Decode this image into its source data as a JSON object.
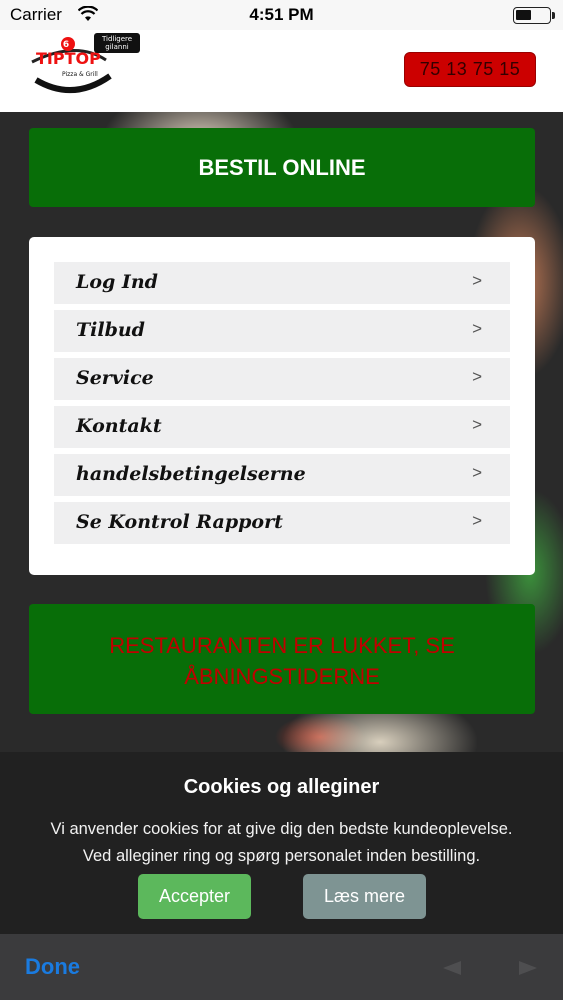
{
  "status_bar": {
    "carrier": "Carrier",
    "time": "4:51 PM"
  },
  "header": {
    "logo_main": "TIPTOP",
    "logo_sub": "Pizza & Grill",
    "logo_badge_line1": "Tidligere",
    "logo_badge_line2": "gilanni",
    "phone": "75 13 75 15"
  },
  "order_button": {
    "label": "BESTIL ONLINE"
  },
  "menu": {
    "items": [
      {
        "label": "Log Ind",
        "chevron": ">"
      },
      {
        "label": "Tilbud",
        "chevron": ">"
      },
      {
        "label": "Service",
        "chevron": ">"
      },
      {
        "label": "Kontakt",
        "chevron": ">"
      },
      {
        "label": "handelsbetingelserne",
        "chevron": ">"
      },
      {
        "label": "Se Kontrol Rapport",
        "chevron": ">"
      }
    ]
  },
  "closed_banner": {
    "line1": "RESTAURANTEN ER LUKKET, SE",
    "line2": "ÅBNINGSTIDERNE"
  },
  "cookie": {
    "title": "Cookies og alleginer",
    "line1": "Vi anvender cookies for at give dig den bedste kundeoplevelse.",
    "line2": "Ved alleginer ring og spørg personalet inden bestilling.",
    "accept_label": "Accepter",
    "read_more_label": "Læs mere"
  },
  "toolbar": {
    "done_label": "Done"
  },
  "colors": {
    "order_green": "#086e08",
    "phone_red": "#cc0000",
    "accept_green": "#5cb85c",
    "read_more_gray": "#7e9493",
    "done_blue": "#1a7be0"
  },
  "icons": [
    "wifi-icon",
    "battery-icon",
    "back-arrow-icon",
    "forward-arrow-icon"
  ]
}
